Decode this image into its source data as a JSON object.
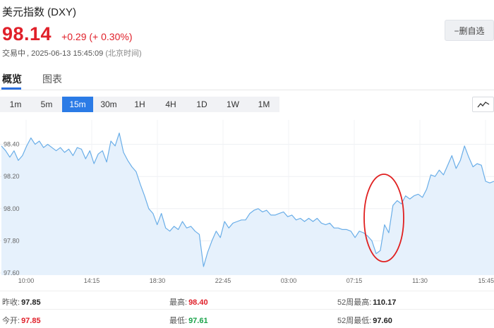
{
  "header": {
    "title": "美元指数 (DXY)",
    "price": "98.14",
    "change": "+0.29 (+ 0.30%)",
    "status": "交易中",
    "timestamp": "2025-06-13 15:45:09",
    "timezone": "(北京时间)",
    "watch_button": "−删自选"
  },
  "tabs": [
    {
      "label": "概览",
      "active": true
    },
    {
      "label": "图表",
      "active": false
    }
  ],
  "intervals": [
    {
      "label": "1m",
      "active": false
    },
    {
      "label": "5m",
      "active": false
    },
    {
      "label": "15m",
      "active": true
    },
    {
      "label": "30m",
      "active": false
    },
    {
      "label": "1H",
      "active": false
    },
    {
      "label": "4H",
      "active": false
    },
    {
      "label": "1D",
      "active": false
    },
    {
      "label": "1W",
      "active": false
    },
    {
      "label": "1M",
      "active": false
    }
  ],
  "chart_toggle_icon": "line-chart-icon",
  "chart_data": {
    "type": "area",
    "x_tick_labels": [
      "10:00",
      "14:15",
      "18:30",
      "22:45",
      "03:00",
      "07:15",
      "11:30",
      "15:45"
    ],
    "y_tick_labels": [
      "98.40",
      "98.20",
      "98.00",
      "97.80",
      "97.60"
    ],
    "ylim": [
      97.6,
      98.5
    ],
    "grid": true,
    "line_color": "#6aaee8",
    "fill_color": "#e6f1fc",
    "annotation": "red ellipse around the sharp rebound near 08:00",
    "values": [
      98.39,
      98.36,
      98.32,
      98.36,
      98.3,
      98.33,
      98.39,
      98.44,
      98.4,
      98.42,
      98.38,
      98.4,
      98.38,
      98.36,
      98.38,
      98.35,
      98.37,
      98.33,
      98.38,
      98.37,
      98.31,
      98.36,
      98.28,
      98.34,
      98.36,
      98.29,
      98.42,
      98.39,
      98.47,
      98.35,
      98.3,
      98.26,
      98.23,
      98.15,
      98.08,
      98.0,
      97.97,
      97.9,
      97.97,
      97.88,
      97.86,
      97.89,
      97.87,
      97.92,
      97.88,
      97.89,
      97.86,
      97.84,
      97.64,
      97.73,
      97.8,
      97.86,
      97.82,
      97.92,
      97.88,
      97.91,
      97.92,
      97.93,
      97.93,
      97.97,
      97.99,
      98.0,
      97.98,
      97.99,
      97.96,
      97.96,
      97.97,
      97.98,
      97.95,
      97.96,
      97.93,
      97.94,
      97.92,
      97.94,
      97.92,
      97.94,
      97.91,
      97.9,
      97.91,
      97.88,
      97.88,
      97.87,
      97.87,
      97.86,
      97.82,
      97.86,
      97.85,
      97.83,
      97.8,
      97.72,
      97.74,
      97.9,
      97.85,
      98.02,
      98.05,
      98.03,
      98.08,
      98.06,
      98.08,
      98.09,
      98.07,
      98.12,
      98.21,
      98.2,
      98.24,
      98.21,
      98.27,
      98.33,
      98.25,
      98.3,
      98.39,
      98.32,
      98.26,
      98.28,
      98.27,
      98.17,
      98.16,
      98.17
    ],
    "stats_y_axis_note": ""
  },
  "stats": {
    "rows": [
      [
        {
          "label": "昨收:",
          "value": "97.85",
          "tone": "neutral"
        },
        {
          "label": "最高:",
          "value": "98.40",
          "tone": "up"
        },
        {
          "label": "52周最高:",
          "value": "110.17",
          "tone": "neutral"
        }
      ],
      [
        {
          "label": "今开:",
          "value": "97.85",
          "tone": "up"
        },
        {
          "label": "最低:",
          "value": "97.61",
          "tone": "down"
        },
        {
          "label": "52周最低:",
          "value": "97.60",
          "tone": "neutral"
        }
      ]
    ]
  }
}
